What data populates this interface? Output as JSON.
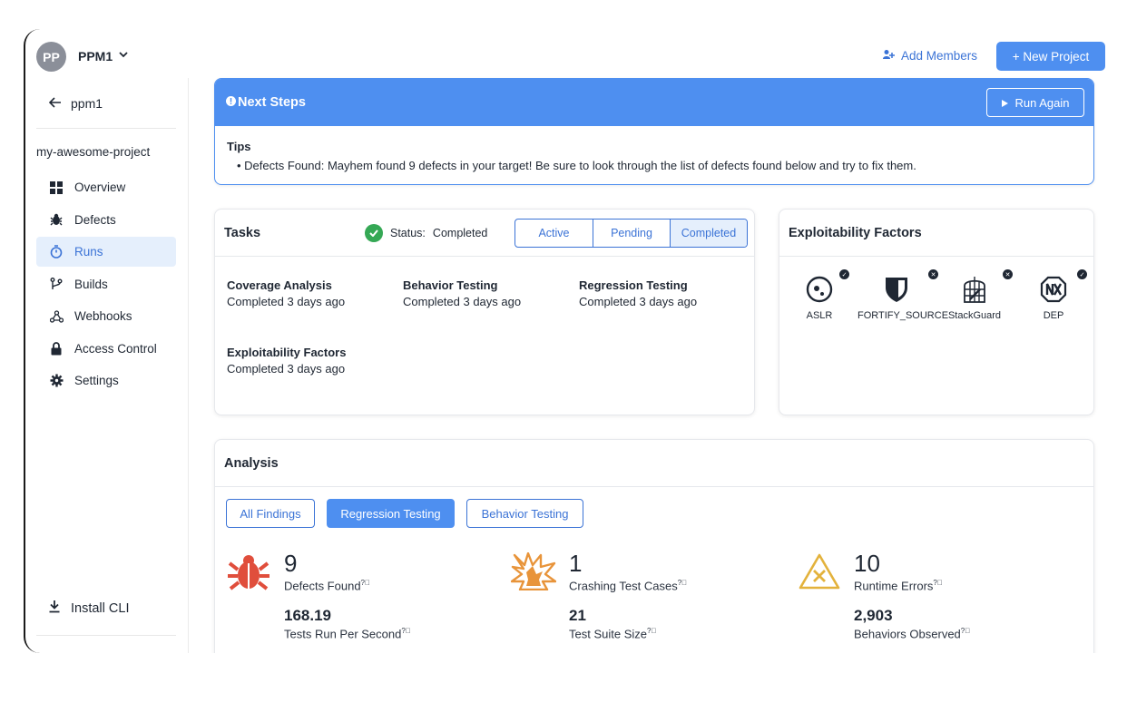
{
  "header": {
    "avatar_initials": "PP",
    "org_name": "PPM1",
    "add_members_label": "Add Members",
    "new_project_label": "+ New Project"
  },
  "sidebar": {
    "back_label": "ppm1",
    "project_name": "my-awesome-project",
    "items": [
      {
        "label": "Overview",
        "icon": "grid-icon"
      },
      {
        "label": "Defects",
        "icon": "bug-icon"
      },
      {
        "label": "Runs",
        "icon": "stopwatch-icon",
        "active": true
      },
      {
        "label": "Builds",
        "icon": "branch-icon"
      },
      {
        "label": "Webhooks",
        "icon": "webhook-icon"
      },
      {
        "label": "Access Control",
        "icon": "lock-icon"
      },
      {
        "label": "Settings",
        "icon": "gear-icon"
      }
    ],
    "install_cli_label": "Install CLI"
  },
  "next_steps": {
    "title": "Next Steps",
    "run_again_label": "Run Again",
    "tips_title": "Tips",
    "tip": "Defects Found: Mayhem found 9 defects in your target! Be sure to look through the list of defects found below and try to fix them."
  },
  "tasks": {
    "title": "Tasks",
    "status_label": "Status:",
    "status_value": "Completed",
    "tabs": [
      "Active",
      "Pending",
      "Completed"
    ],
    "selected_tab": "Completed",
    "items": [
      {
        "name": "Coverage Analysis",
        "status": "Completed 3 days ago"
      },
      {
        "name": "Behavior Testing",
        "status": "Completed 3 days ago"
      },
      {
        "name": "Regression Testing",
        "status": "Completed 3 days ago"
      },
      {
        "name": "Exploitability Factors",
        "status": "Completed 3 days ago"
      }
    ]
  },
  "exploitability": {
    "title": "Exploitability Factors",
    "factors": [
      {
        "label": "ASLR",
        "state": "check"
      },
      {
        "label": "FORTIFY_SOURCE",
        "state": "x"
      },
      {
        "label": "StackGuard",
        "state": "x"
      },
      {
        "label": "DEP",
        "state": "check"
      }
    ]
  },
  "analysis": {
    "title": "Analysis",
    "filters": [
      "All Findings",
      "Regression Testing",
      "Behavior Testing"
    ],
    "selected_filter": "Regression Testing",
    "metrics": [
      {
        "value": "9",
        "label": "Defects Found",
        "value2": "168.19",
        "label2": "Tests Run Per Second",
        "icon": "bug-icon",
        "color": "#e04e3c"
      },
      {
        "value": "1",
        "label": "Crashing Test Cases",
        "value2": "21",
        "label2": "Test Suite Size",
        "icon": "crash-icon",
        "color": "#e8943a"
      },
      {
        "value": "10",
        "label": "Runtime Errors",
        "value2": "2,903",
        "label2": "Behaviors Observed",
        "icon": "warning-icon",
        "color": "#e3b23c"
      }
    ]
  },
  "colors": {
    "accent": "#4e8ff0",
    "link": "#3b73d6",
    "active_nav_bg": "#e5effc",
    "success": "#35a855"
  }
}
